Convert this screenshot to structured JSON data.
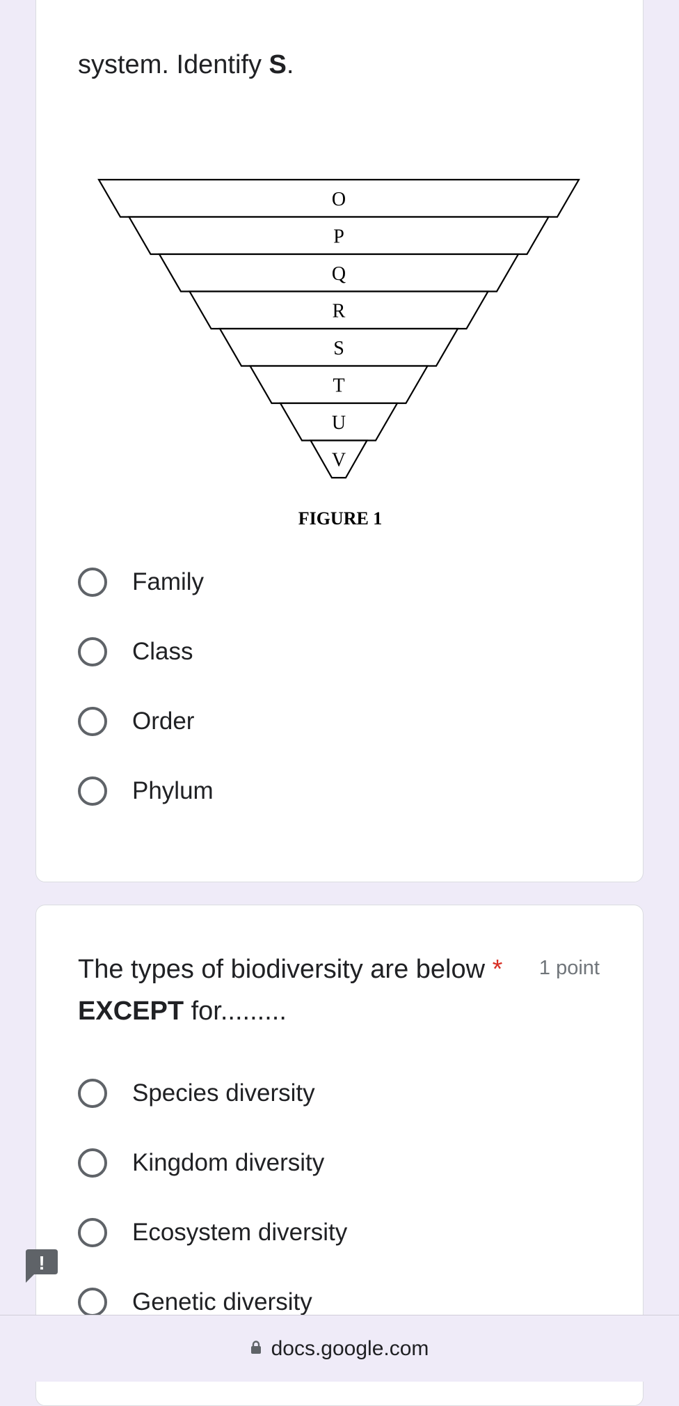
{
  "question1": {
    "text_tail": "system. Identify ",
    "text_bold": "S",
    "text_end": ".",
    "figure": {
      "tiers": [
        "O",
        "P",
        "Q",
        "R",
        "S",
        "T",
        "U",
        "V"
      ],
      "caption": "FIGURE 1"
    },
    "options": [
      {
        "label": "Family",
        "selected": false
      },
      {
        "label": "Class",
        "selected": false
      },
      {
        "label": "Order",
        "selected": false
      },
      {
        "label": "Phylum",
        "selected": false
      }
    ]
  },
  "question2": {
    "text_start": "The types of biodiversity are below ",
    "required_mark": "*",
    "points": "1 point",
    "text_bold": "EXCEPT",
    "text_end": " for.........",
    "options": [
      {
        "label": "Species diversity",
        "selected": false
      },
      {
        "label": "Kingdom diversity",
        "selected": false
      },
      {
        "label": "Ecosystem diversity",
        "selected": false
      },
      {
        "label": "Genetic diversity",
        "selected": false
      }
    ]
  },
  "address_bar": {
    "icon": "lock-icon",
    "url": "docs.google.com"
  },
  "feedback": {
    "icon": "report-icon",
    "symbol": "!"
  },
  "colors": {
    "background": "#efebf8",
    "card": "#ffffff",
    "required": "#d93025",
    "radio_border": "#5f6368"
  }
}
